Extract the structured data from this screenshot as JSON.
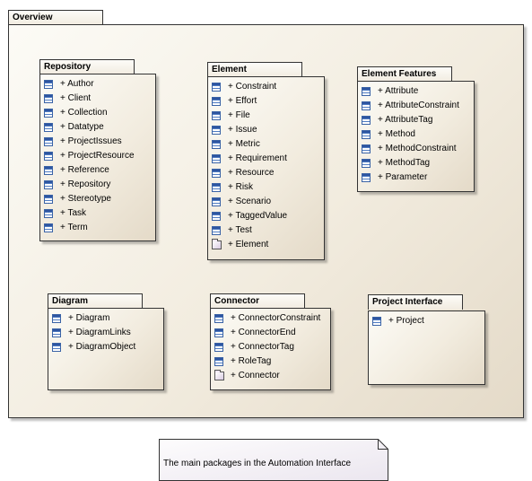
{
  "diagram": {
    "overview": {
      "title": "Overview"
    },
    "packages": {
      "repository": {
        "title": "Repository",
        "items": [
          {
            "label": "+ Author",
            "icon": "class-icon"
          },
          {
            "label": "+ Client",
            "icon": "class-icon"
          },
          {
            "label": "+ Collection",
            "icon": "class-icon"
          },
          {
            "label": "+ Datatype",
            "icon": "class-icon"
          },
          {
            "label": "+ ProjectIssues",
            "icon": "class-icon"
          },
          {
            "label": "+ ProjectResource",
            "icon": "class-icon"
          },
          {
            "label": "+ Reference",
            "icon": "class-icon"
          },
          {
            "label": "+ Repository",
            "icon": "class-icon"
          },
          {
            "label": "+ Stereotype",
            "icon": "class-icon"
          },
          {
            "label": "+ Task",
            "icon": "class-icon"
          },
          {
            "label": "+ Term",
            "icon": "class-icon"
          }
        ]
      },
      "element": {
        "title": "Element",
        "items": [
          {
            "label": "+ Constraint",
            "icon": "class-icon"
          },
          {
            "label": "+ Effort",
            "icon": "class-icon"
          },
          {
            "label": "+ File",
            "icon": "class-icon"
          },
          {
            "label": "+ Issue",
            "icon": "class-icon"
          },
          {
            "label": "+ Metric",
            "icon": "class-icon"
          },
          {
            "label": "+ Requirement",
            "icon": "class-icon"
          },
          {
            "label": "+ Resource",
            "icon": "class-icon"
          },
          {
            "label": "+ Risk",
            "icon": "class-icon"
          },
          {
            "label": "+ Scenario",
            "icon": "class-icon"
          },
          {
            "label": "+ TaggedValue",
            "icon": "class-icon"
          },
          {
            "label": "+ Test",
            "icon": "class-icon"
          },
          {
            "label": "+ Element",
            "icon": "package-icon"
          }
        ]
      },
      "element_features": {
        "title": "Element Features",
        "items": [
          {
            "label": "+ Attribute",
            "icon": "class-icon"
          },
          {
            "label": "+ AttributeConstraint",
            "icon": "class-icon"
          },
          {
            "label": "+ AttributeTag",
            "icon": "class-icon"
          },
          {
            "label": "+ Method",
            "icon": "class-icon"
          },
          {
            "label": "+ MethodConstraint",
            "icon": "class-icon"
          },
          {
            "label": "+ MethodTag",
            "icon": "class-icon"
          },
          {
            "label": "+ Parameter",
            "icon": "class-icon"
          }
        ]
      },
      "diagram": {
        "title": "Diagram",
        "items": [
          {
            "label": "+ Diagram",
            "icon": "class-icon"
          },
          {
            "label": "+ DiagramLinks",
            "icon": "class-icon"
          },
          {
            "label": "+ DiagramObject",
            "icon": "class-icon"
          }
        ]
      },
      "connector": {
        "title": "Connector",
        "items": [
          {
            "label": "+ ConnectorConstraint",
            "icon": "class-icon"
          },
          {
            "label": "+ ConnectorEnd",
            "icon": "class-icon"
          },
          {
            "label": "+ ConnectorTag",
            "icon": "class-icon"
          },
          {
            "label": "+ RoleTag",
            "icon": "class-icon"
          },
          {
            "label": "+ Connector",
            "icon": "package-icon"
          }
        ]
      },
      "project_interface": {
        "title": "Project Interface",
        "items": [
          {
            "label": "+ Project",
            "icon": "class-icon"
          }
        ]
      }
    },
    "note": {
      "text": "The main packages in the Automation Interface"
    }
  }
}
